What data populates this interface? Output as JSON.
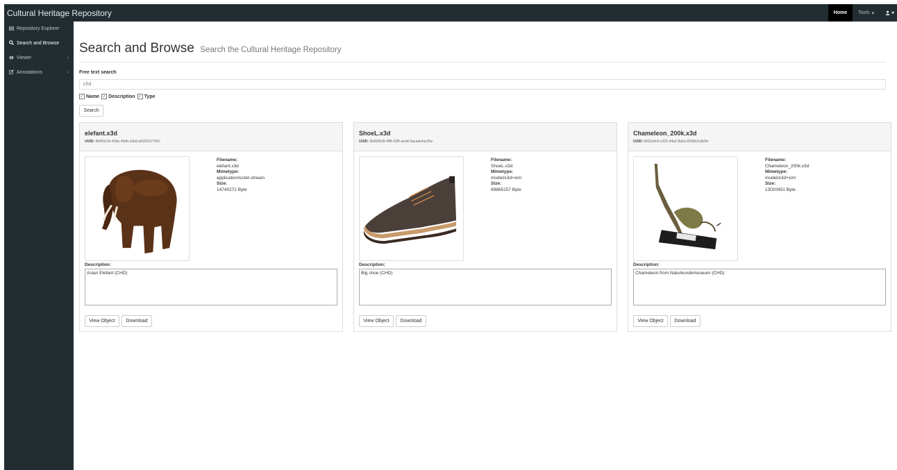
{
  "app": {
    "title": "Cultural Heritage Repository"
  },
  "nav": {
    "home": "Home",
    "tools": "Tools",
    "tools_caret": "▾",
    "user_icon": "user-icon",
    "user_caret": "▾"
  },
  "sidebar": {
    "items": [
      {
        "icon": "table-icon",
        "label": "Repository Explorer",
        "chevron": ""
      },
      {
        "icon": "search-icon",
        "label": "Search and Browse",
        "chevron": ""
      },
      {
        "icon": "eye-icon",
        "label": "Viewer",
        "chevron": "‹"
      },
      {
        "icon": "edit-icon",
        "label": "Annotations",
        "chevron": "‹"
      }
    ]
  },
  "page": {
    "title": "Search and Browse",
    "subtitle": "Search the Cultural Heritage Repository"
  },
  "search": {
    "label": "Free text search",
    "value": "chd",
    "filters": [
      {
        "label": "Name",
        "checked": true
      },
      {
        "label": "Description",
        "checked": true
      },
      {
        "label": "Type",
        "checked": true
      }
    ],
    "button": "Search"
  },
  "results": [
    {
      "title": "elefant.x3d",
      "uuid_label": "UUID:",
      "uuid": "4b450c2b-42de-46db-a3bd-af420237782c",
      "filename_label": "Filename:",
      "filename": "elefant.x3d",
      "mimetype_label": "Mimetype:",
      "mimetype": "application/octet-stream",
      "size_label": "Size:",
      "size": "14740271 Byte",
      "description_label": "Description:",
      "description": "Asian Elefant (CHD)",
      "view_button": "View Object",
      "download_button": "Download"
    },
    {
      "title": "ShoeL.x3d",
      "uuid_label": "UUID:",
      "uuid": "9b6b3628-0ff8-43f9-aedd-3acade4ac93e",
      "filename_label": "Filename:",
      "filename": "ShoeL.x3d",
      "mimetype_label": "Mimetype:",
      "mimetype": "model/x3d+xml",
      "size_label": "Size:",
      "size": "69865157 Byte",
      "description_label": "Description:",
      "description": "Big shoe (CHD)",
      "view_button": "View Object",
      "download_button": "Download"
    },
    {
      "title": "Chameleon_200k.x3d",
      "uuid_label": "UUID:",
      "uuid": "b652a4c6-e332-44a2-8a0a-930bb2cdb5fc",
      "filename_label": "Filename:",
      "filename": "Chameleon_200k.x3d",
      "mimetype_label": "Mimetype:",
      "mimetype": "model/x3d+xml",
      "size_label": "Size:",
      "size": "13020451 Byte",
      "description_label": "Description:",
      "description": "Chameleon from Naturkundemuseum (CHD)",
      "view_button": "View Object",
      "download_button": "Download"
    }
  ],
  "colors": {
    "sidebar_bg": "#222d32",
    "navbar_bg": "#222d32",
    "card_header_bg": "#f5f5f5"
  }
}
